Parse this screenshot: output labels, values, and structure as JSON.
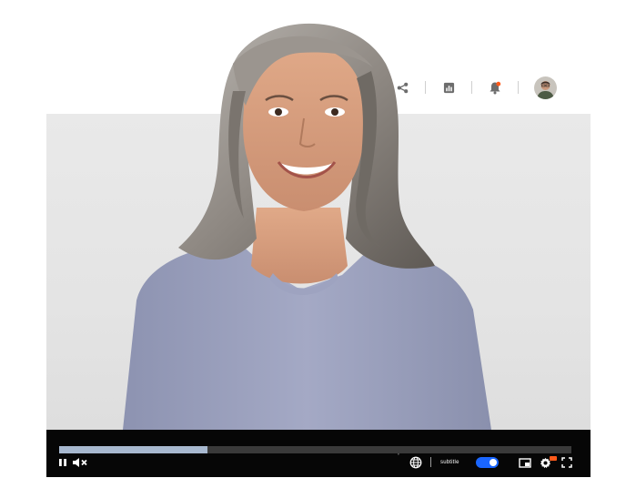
{
  "player": {
    "progress": 0.29,
    "muted": true,
    "playing": true,
    "subtitle_label": "subtitle",
    "subtitles_enabled": true
  },
  "colors": {
    "accent": "#1a66ff",
    "progress_fill": "#a7b8cf",
    "control_bar": "#060606",
    "badge": "#ff5a1a"
  },
  "icons": {
    "top": [
      "share-icon",
      "analytics-icon",
      "notification-bell-icon",
      "user-avatar"
    ],
    "controls": [
      "pause-icon",
      "mute-icon",
      "language-icon",
      "picture-in-picture-icon",
      "settings-icon",
      "fullscreen-icon"
    ]
  }
}
